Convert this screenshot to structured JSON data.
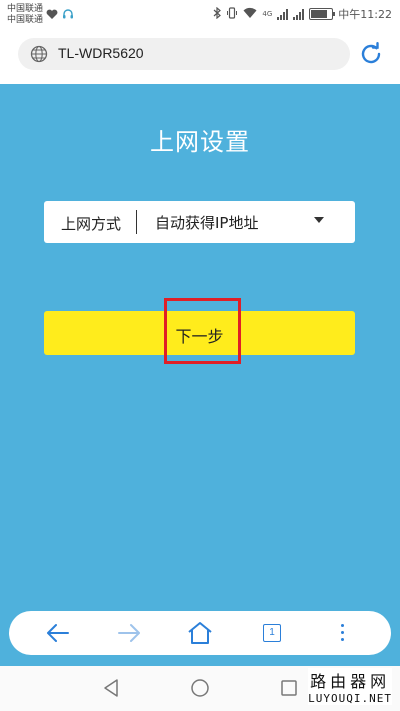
{
  "status_bar": {
    "carrier_1": "中国联通",
    "carrier_2": "中国联通",
    "network_type": "4G",
    "time": "中午11:22",
    "battery_level": 0.7
  },
  "browser": {
    "url": "TL-WDR5620"
  },
  "page": {
    "title": "上网设置",
    "connection_type_label": "上网方式",
    "connection_type_value": "自动获得IP地址",
    "next_button_label": "下一步"
  },
  "toolbar": {
    "tab_count": "1"
  },
  "watermark": {
    "chinese": "路由器网",
    "domain": "LUYOUQI.NET"
  },
  "colors": {
    "background": "#4fb1dc",
    "button": "#ffec1c",
    "highlight": "#e01f26",
    "accent": "#2b7fd9"
  }
}
